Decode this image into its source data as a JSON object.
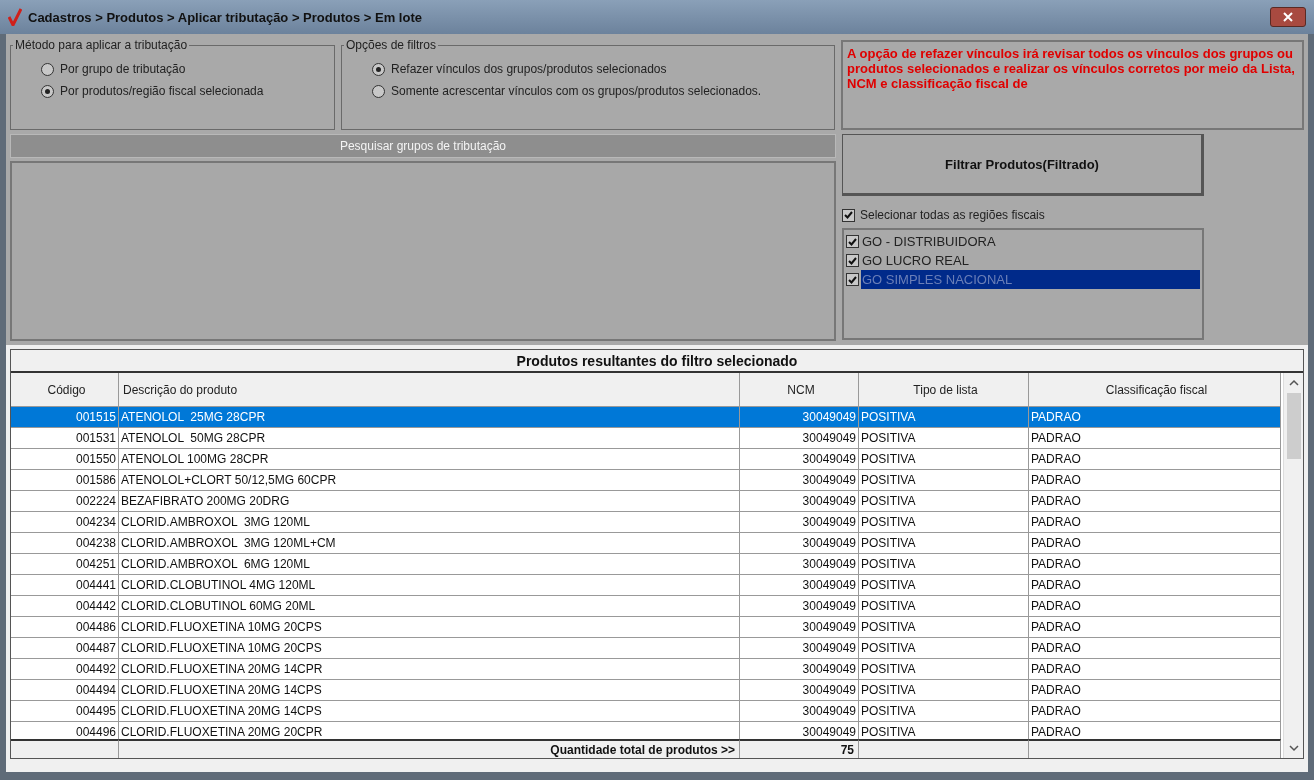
{
  "window": {
    "title": "Cadastros > Produtos > Aplicar tributação > Produtos > Em lote"
  },
  "metodo": {
    "title": "Método para aplicar a tributação",
    "options": [
      {
        "label": "Por grupo de tributação",
        "selected": false
      },
      {
        "label": "Por produtos/região fiscal selecionada",
        "selected": true
      }
    ]
  },
  "filtros": {
    "title": "Opções de filtros",
    "options": [
      {
        "label": "Refazer vínculos dos grupos/produtos selecionados",
        "selected": true
      },
      {
        "label": "Somente acrescentar vínculos com os grupos/produtos selecionados.",
        "selected": false
      }
    ]
  },
  "warning": "A opção de refazer vínculos irá revisar todos os vínculos dos grupos ou produtos selecionados e realizar os vínculos corretos por meio da Lista, NCM e classificação fiscal de",
  "search_groups_button": {
    "label": "Pesquisar grupos de tributação",
    "disabled": true
  },
  "filter_button": "Filtrar Produtos(Filtrado)",
  "select_all": {
    "label": "Selecionar todas as regiões fiscais",
    "checked": true
  },
  "regions": [
    {
      "label": "GO - DISTRIBUIDORA",
      "checked": true,
      "selected": false
    },
    {
      "label": "GO LUCRO REAL",
      "checked": true,
      "selected": false
    },
    {
      "label": "GO SIMPLES NACIONAL",
      "checked": true,
      "selected": true
    }
  ],
  "table": {
    "title": "Produtos resultantes do filtro selecionado",
    "columns": [
      "Código",
      "Descrição do produto",
      "NCM",
      "Tipo de lista",
      "Classificação fiscal"
    ],
    "rows": [
      {
        "cells": [
          "001515",
          "ATENOLOL  25MG 28CPR",
          "30049049",
          "POSITIVA",
          "PADRAO"
        ],
        "selected": true
      },
      {
        "cells": [
          "001531",
          "ATENOLOL  50MG 28CPR",
          "30049049",
          "POSITIVA",
          "PADRAO"
        ],
        "selected": false
      },
      {
        "cells": [
          "001550",
          "ATENOLOL 100MG 28CPR",
          "30049049",
          "POSITIVA",
          "PADRAO"
        ],
        "selected": false
      },
      {
        "cells": [
          "001586",
          "ATENOLOL+CLORT 50/12,5MG 60CPR",
          "30049049",
          "POSITIVA",
          "PADRAO"
        ],
        "selected": false
      },
      {
        "cells": [
          "002224",
          "BEZAFIBRATO 200MG 20DRG",
          "30049049",
          "POSITIVA",
          "PADRAO"
        ],
        "selected": false
      },
      {
        "cells": [
          "004234",
          "CLORID.AMBROXOL  3MG 120ML",
          "30049049",
          "POSITIVA",
          "PADRAO"
        ],
        "selected": false
      },
      {
        "cells": [
          "004238",
          "CLORID.AMBROXOL  3MG 120ML+CM",
          "30049049",
          "POSITIVA",
          "PADRAO"
        ],
        "selected": false
      },
      {
        "cells": [
          "004251",
          "CLORID.AMBROXOL  6MG 120ML",
          "30049049",
          "POSITIVA",
          "PADRAO"
        ],
        "selected": false
      },
      {
        "cells": [
          "004441",
          "CLORID.CLOBUTINOL 4MG 120ML",
          "30049049",
          "POSITIVA",
          "PADRAO"
        ],
        "selected": false
      },
      {
        "cells": [
          "004442",
          "CLORID.CLOBUTINOL 60MG 20ML",
          "30049049",
          "POSITIVA",
          "PADRAO"
        ],
        "selected": false
      },
      {
        "cells": [
          "004486",
          "CLORID.FLUOXETINA 10MG 20CPS",
          "30049049",
          "POSITIVA",
          "PADRAO"
        ],
        "selected": false
      },
      {
        "cells": [
          "004487",
          "CLORID.FLUOXETINA 10MG 20CPS",
          "30049049",
          "POSITIVA",
          "PADRAO"
        ],
        "selected": false
      },
      {
        "cells": [
          "004492",
          "CLORID.FLUOXETINA 20MG 14CPR",
          "30049049",
          "POSITIVA",
          "PADRAO"
        ],
        "selected": false
      },
      {
        "cells": [
          "004494",
          "CLORID.FLUOXETINA 20MG 14CPS",
          "30049049",
          "POSITIVA",
          "PADRAO"
        ],
        "selected": false
      },
      {
        "cells": [
          "004495",
          "CLORID.FLUOXETINA 20MG 14CPS",
          "30049049",
          "POSITIVA",
          "PADRAO"
        ],
        "selected": false
      },
      {
        "cells": [
          "004496",
          "CLORID.FLUOXETINA 20MG 20CPR",
          "30049049",
          "POSITIVA",
          "PADRAO"
        ],
        "selected": false
      }
    ],
    "footer": {
      "label": "Quantidade total de produtos >>",
      "total": "75"
    }
  }
}
